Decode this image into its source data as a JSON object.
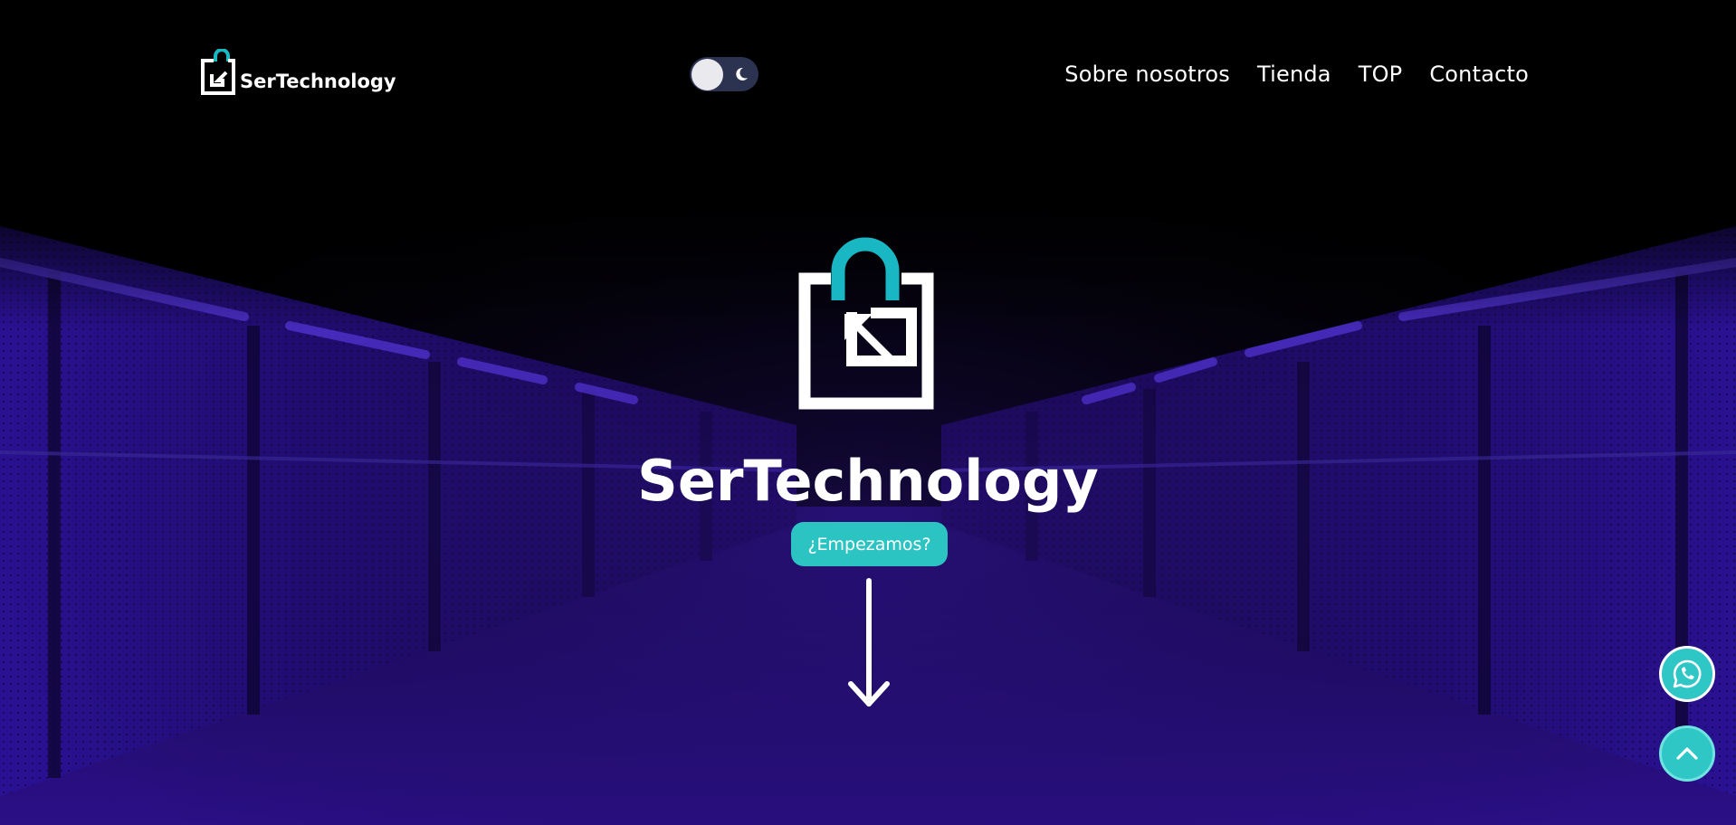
{
  "brand": {
    "name": "SerTechnology",
    "logo_icon": "shopping-bag-arrow-icon"
  },
  "theme_toggle": {
    "state": "dark",
    "icon": "moon-icon"
  },
  "nav": {
    "items": [
      {
        "label": "Sobre nosotros"
      },
      {
        "label": "Tienda"
      },
      {
        "label": "TOP"
      },
      {
        "label": "Contacto"
      }
    ]
  },
  "hero": {
    "title": "SerTechnology",
    "cta_label": "¿Empezamos?",
    "scroll_icon": "arrow-down-icon"
  },
  "floating": {
    "whatsapp_icon": "whatsapp-icon",
    "back_to_top_icon": "chevron-up-icon"
  },
  "colors": {
    "accent": "#2cc4c3",
    "logo_accent": "#19b7c4",
    "background": "#000000",
    "neon": "#3a12b8"
  }
}
